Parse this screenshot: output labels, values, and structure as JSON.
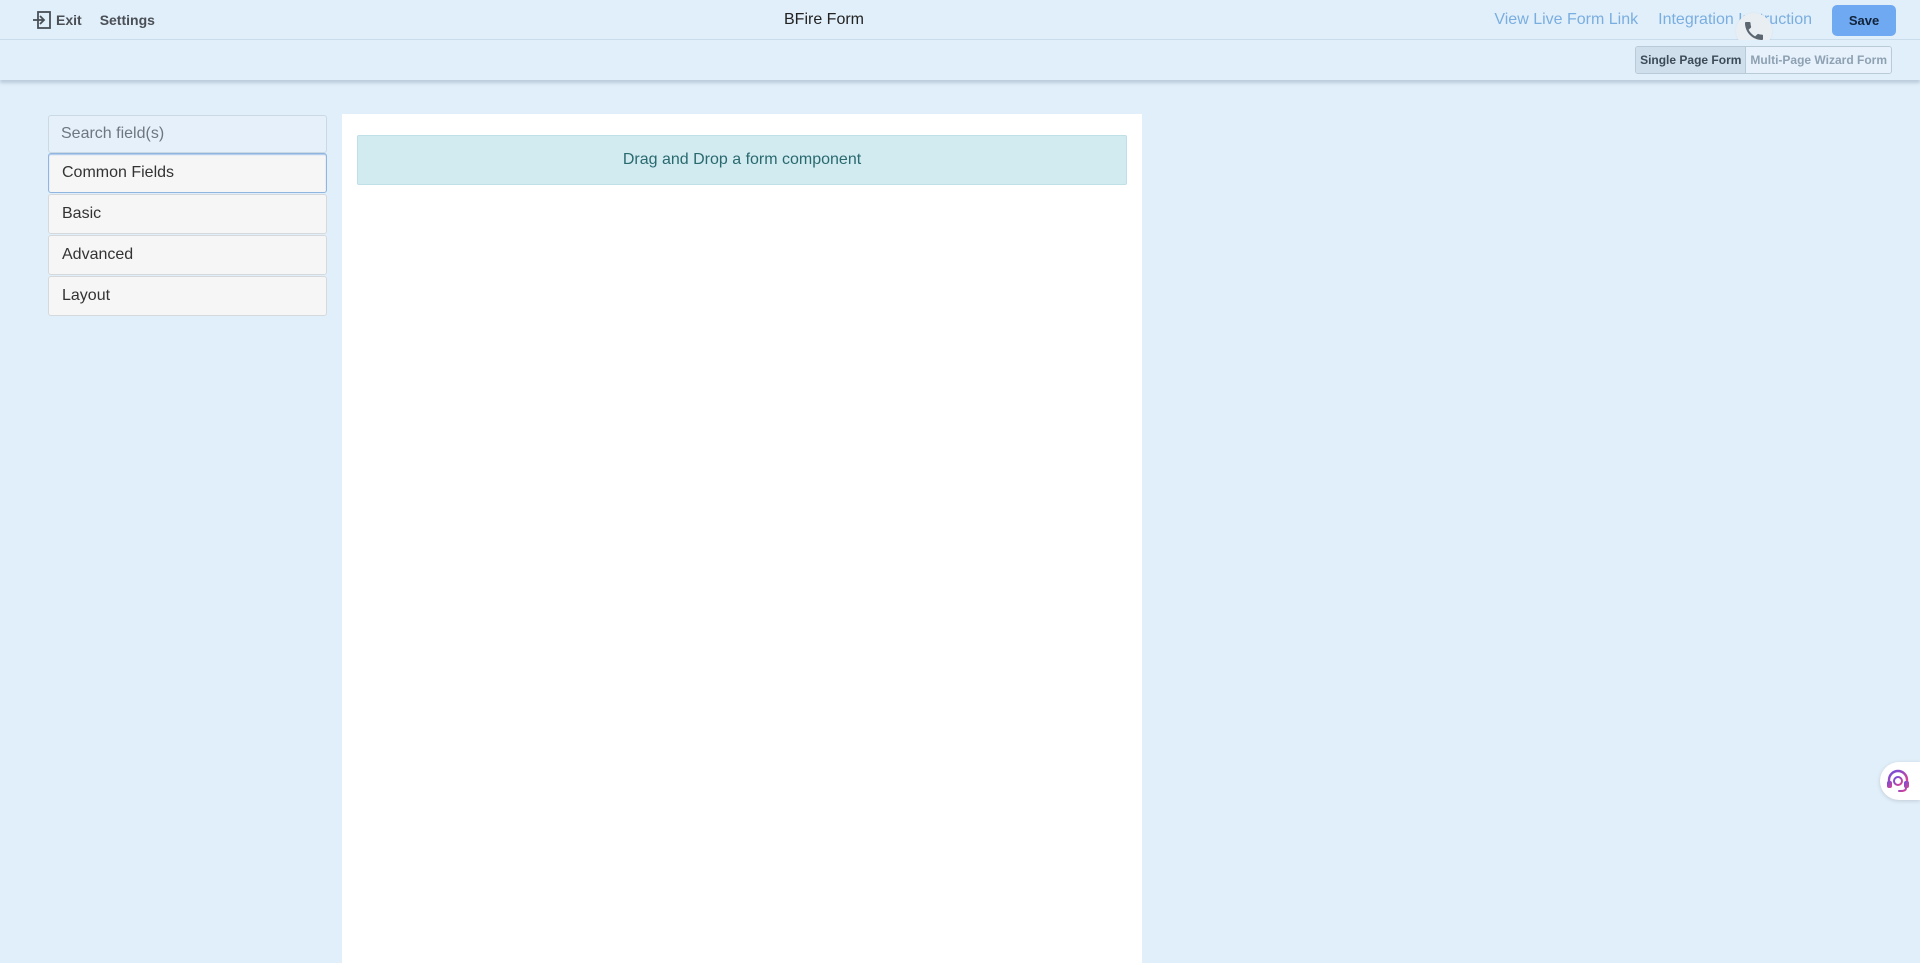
{
  "topbar": {
    "exit_label": "Exit",
    "settings_label": "Settings",
    "title": "BFire Form",
    "view_live_link": "View Live Form Link",
    "integration_link": "Integration Instruction",
    "save_label": "Save"
  },
  "mode_switch": {
    "single_page": "Single Page Form",
    "multi_page": "Multi-Page Wizard Form",
    "active": "single_page"
  },
  "sidebar": {
    "search_placeholder": "Search field(s)",
    "groups": [
      {
        "label": "Common Fields"
      },
      {
        "label": "Basic"
      },
      {
        "label": "Advanced"
      },
      {
        "label": "Layout"
      }
    ]
  },
  "canvas": {
    "drop_text": "Drag and Drop a form component"
  },
  "icons": {
    "exit": "exit-icon",
    "phone": "phone-icon",
    "support": "headset-support-icon"
  },
  "colors": {
    "page_bg": "#e1effa",
    "save_button": "#6fa9f2",
    "top_link": "#7aaee0",
    "drop_zone_bg": "#d2ebf1"
  }
}
